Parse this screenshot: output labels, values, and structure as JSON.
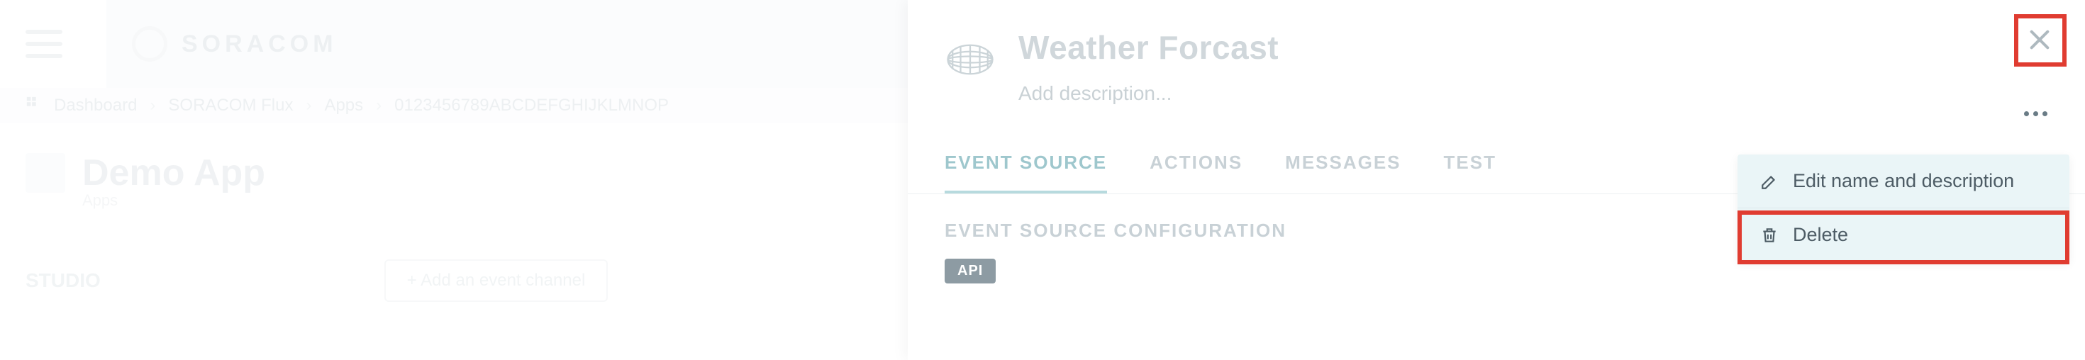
{
  "brand": {
    "name": "SORACOM"
  },
  "breadcrumb": {
    "items": [
      "Dashboard",
      "SORACOM Flux",
      "Apps",
      "0123456789ABCDEFGHIJKLMNOP"
    ]
  },
  "app": {
    "title": "Demo App",
    "subtitle": "Apps"
  },
  "studio": {
    "tab_label": "STUDIO",
    "add_channel_label": "+   Add an event channel"
  },
  "panel": {
    "title": "Weather Forcast",
    "desc_placeholder": "Add description..."
  },
  "tabs": {
    "items": [
      "EVENT SOURCE",
      "ACTIONS",
      "MESSAGES",
      "TEST"
    ],
    "active_index": 0
  },
  "section": {
    "title": "EVENT SOURCE CONFIGURATION",
    "badge": "API"
  },
  "menu": {
    "edit_label": "Edit name and description",
    "delete_label": "Delete"
  }
}
